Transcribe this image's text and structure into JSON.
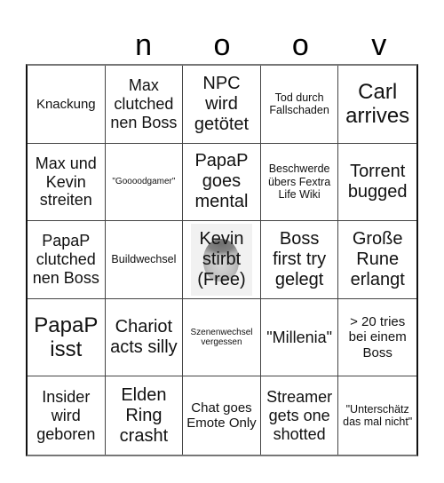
{
  "header": {
    "letters": [
      "",
      "n",
      "o",
      "o",
      "v"
    ]
  },
  "board": {
    "free_cell_image": "face-photo",
    "rows": [
      [
        {
          "text": "Knackung",
          "size": "md"
        },
        {
          "text": "Max clutched nen Boss",
          "size": "lg"
        },
        {
          "text": "NPC wird getötet",
          "size": "xl"
        },
        {
          "text": "Tod durch Fallschaden",
          "size": "sm"
        },
        {
          "text": "Carl arrives",
          "size": "xxl"
        }
      ],
      [
        {
          "text": "Max und Kevin streiten",
          "size": "lg"
        },
        {
          "text": "\"Goooodgamer\"",
          "size": "xs"
        },
        {
          "text": "PapaP goes mental",
          "size": "xl"
        },
        {
          "text": "Beschwerde übers Fextra Life Wiki",
          "size": "sm"
        },
        {
          "text": "Torrent bugged",
          "size": "xl"
        }
      ],
      [
        {
          "text": "PapaP clutched nen Boss",
          "size": "lg"
        },
        {
          "text": "Buildwechsel",
          "size": "sm"
        },
        {
          "text": "Kevin stirbt (Free)",
          "size": "xl",
          "free": true
        },
        {
          "text": "Boss first try gelegt",
          "size": "xl"
        },
        {
          "text": "Große Rune erlangt",
          "size": "xl"
        }
      ],
      [
        {
          "text": "PapaP isst",
          "size": "xxl"
        },
        {
          "text": "Chariot acts silly",
          "size": "xl"
        },
        {
          "text": "Szenenwechsel vergessen",
          "size": "xs"
        },
        {
          "text": "\"Millenia\"",
          "size": "lg"
        },
        {
          "text": "> 20 tries bei einem Boss",
          "size": "md"
        }
      ],
      [
        {
          "text": "Insider wird geboren",
          "size": "lg"
        },
        {
          "text": "Elden Ring crasht",
          "size": "xl"
        },
        {
          "text": "Chat goes Emote Only",
          "size": "md"
        },
        {
          "text": "Streamer gets one shotted",
          "size": "lg"
        },
        {
          "text": "\"Unterschätz das mal nicht\"",
          "size": "sm"
        }
      ]
    ]
  }
}
